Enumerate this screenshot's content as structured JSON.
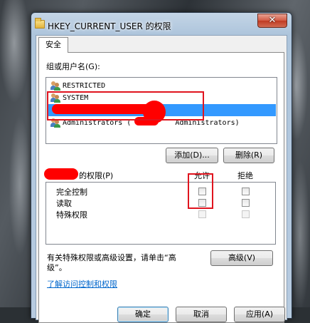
{
  "window": {
    "title": "HKEY_CURRENT_USER 的权限",
    "close_glyph": "✕"
  },
  "tabs": [
    {
      "label": "安全"
    }
  ],
  "group": {
    "label": "组或用户名(G):",
    "users": [
      {
        "name": "RESTRICTED",
        "selected": false
      },
      {
        "name": "SYSTEM",
        "selected": false
      },
      {
        "name": "",
        "selected": true,
        "redacted": true
      },
      {
        "name": "Administrators (",
        "suffix": "Administrators)",
        "selected": false,
        "redacted": true
      }
    ]
  },
  "buttons": {
    "add": "添加(D)...",
    "remove": "删除(R)",
    "advanced": "高级(V)",
    "ok": "确定",
    "cancel": "取消",
    "apply": "应用(A)"
  },
  "permissions": {
    "label": "的权限(P)",
    "allow_header": "允许",
    "deny_header": "拒绝",
    "rows": [
      {
        "name": "完全控制",
        "allow": false,
        "deny": false,
        "enabled": true
      },
      {
        "name": "读取",
        "allow": false,
        "deny": false,
        "enabled": true
      },
      {
        "name": "特殊权限",
        "allow": false,
        "deny": false,
        "enabled": false
      }
    ]
  },
  "advanced_info": {
    "line1": "有关特殊权限或高级设置，请单击“高",
    "line2": "级”。"
  },
  "link": {
    "label": "了解访问控制和权限"
  },
  "colors": {
    "selection": "#3399ff",
    "annotation": "#e0141e",
    "link": "#0066cc"
  },
  "icons": {
    "title": "folder-icon",
    "user": "user-group-icon",
    "close": "close-icon"
  }
}
